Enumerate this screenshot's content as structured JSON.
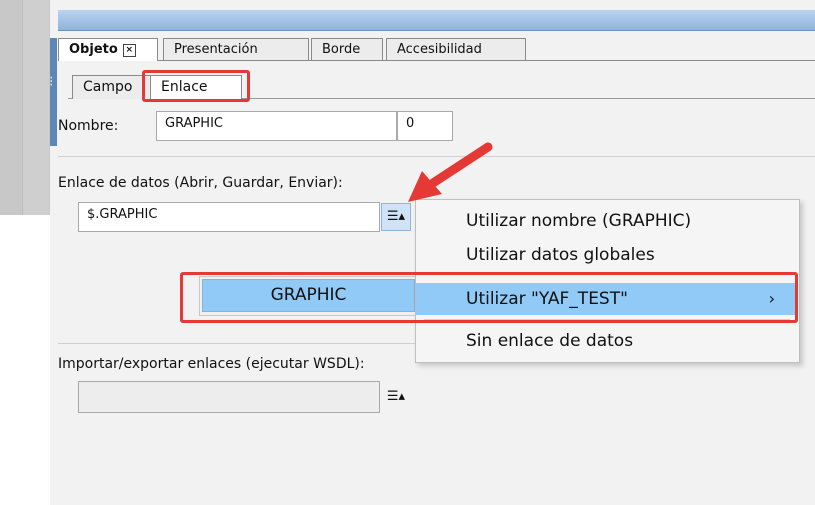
{
  "tabs": [
    {
      "label": "Objeto",
      "active": true,
      "closable": true
    },
    {
      "label": "Presentación",
      "active": false
    },
    {
      "label": "Borde",
      "active": false
    },
    {
      "label": "Accesibilidad",
      "active": false
    }
  ],
  "subtabs": [
    {
      "label": "Campo",
      "active": false
    },
    {
      "label": "Enlace",
      "active": true
    }
  ],
  "name_field": {
    "label": "Nombre:",
    "value": "GRAPHIC",
    "index": "0"
  },
  "data_link": {
    "label": "Enlace de datos (Abrir, Guardar, Enviar):",
    "value": "$.GRAPHIC",
    "button_icon": "list-dropdown-icon"
  },
  "context_menu": {
    "items": [
      {
        "label": "Utilizar nombre (GRAPHIC)"
      },
      {
        "label": "Utilizar datos globales"
      },
      {
        "label": "Utilizar \"YAF_TEST\"",
        "highlighted": true,
        "has_submenu": true
      },
      {
        "label": "Sin enlace de datos"
      }
    ],
    "submenu_chevron": "›"
  },
  "submenu": {
    "items": [
      {
        "label": "GRAPHIC",
        "highlighted": true
      }
    ]
  },
  "import_export": {
    "label": "Importar/exportar enlaces (ejecutar WSDL):",
    "value": "",
    "button_icon": "list-dropdown-icon"
  },
  "colors": {
    "highlight": "#91c9f7",
    "annotation": "#e53935",
    "header_blue": "#8fb2dd"
  }
}
